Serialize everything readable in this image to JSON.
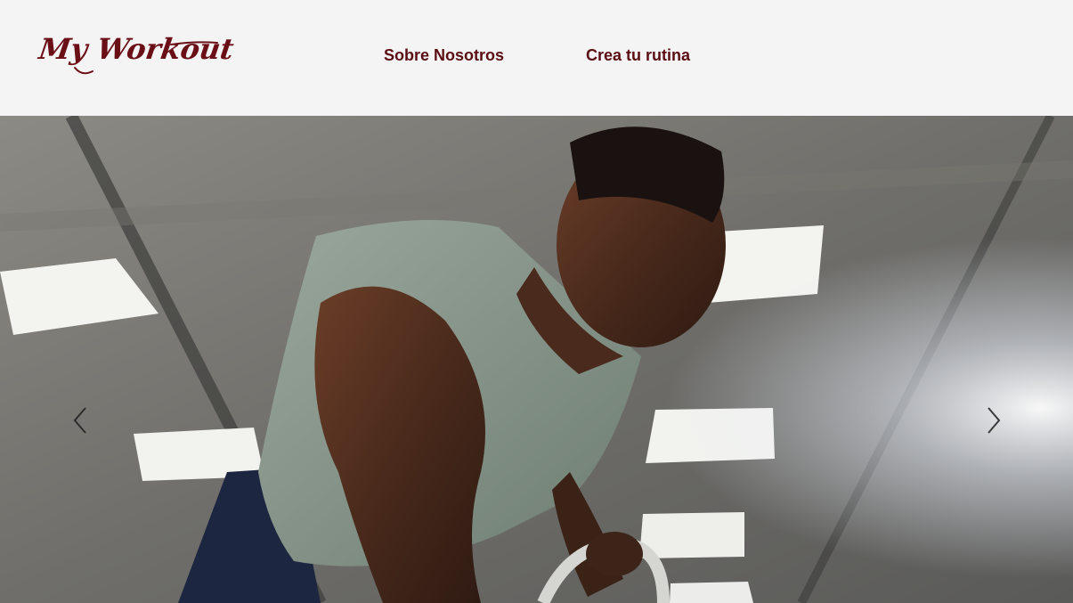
{
  "header": {
    "logo_text": "My Workout",
    "nav": [
      {
        "label": "Sobre Nosotros"
      },
      {
        "label": "Crea tu rutina"
      }
    ]
  },
  "carousel": {
    "prev_icon": "chevron-left-icon",
    "next_icon": "chevron-right-icon"
  },
  "colors": {
    "brand": "#6b0f17",
    "header_bg": "#f4f4f4"
  }
}
